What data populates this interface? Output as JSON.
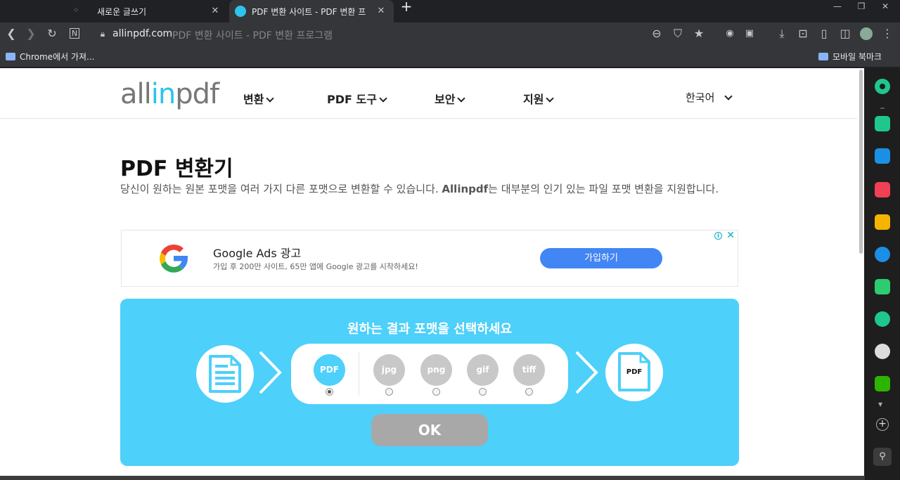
{
  "tabs": [
    {
      "title": "새로운 글쓰기",
      "close": "✕"
    },
    {
      "title": "PDF 변환 사이트 - PDF 변환 프",
      "close": "✕"
    }
  ],
  "new_tab": "+",
  "window_controls": {
    "minimize": "—",
    "restore": "❐",
    "close": "✕"
  },
  "address": {
    "host": "allinpdf.com",
    "title": "PDF 변환 사이트 - PDF 변환 프로그램"
  },
  "bookmarks": {
    "left": "Chrome에서 가져...",
    "right": "모바일 북마크"
  },
  "site": {
    "logo_a": "all",
    "logo_b": "in",
    "logo_c": "pdf",
    "nav": [
      "변환",
      "PDF 도구",
      "보안",
      "지원"
    ],
    "language": "한국어",
    "heading": "PDF 변환기",
    "desc_1": "당신이 원하는 원본 포맷을 여러 가지 다른 포맷으로 변환할 수 있습니다. ",
    "desc_brand": "Allinpdf",
    "desc_2": "는 대부분의 인기 있는 파일 포맷 변환을 지원합니다."
  },
  "ad": {
    "title": "Google Ads 광고",
    "subtitle": "가입 후 200만 사이트, 65만 앱에 Google 광고를 시작하세요!",
    "button": "가입하기",
    "info": "i",
    "close": "✕"
  },
  "converter": {
    "title": "원하는 결과 포맷을 선택하세요",
    "formats": [
      "PDF",
      "jpg",
      "png",
      "gif",
      "tiff"
    ],
    "selected": "PDF",
    "target_label": "PDF",
    "ok": "OK"
  },
  "colors": {
    "accent": "#4dd0fa",
    "ad_button": "#4285f4",
    "logo_highlight": "#2fc3ee"
  }
}
